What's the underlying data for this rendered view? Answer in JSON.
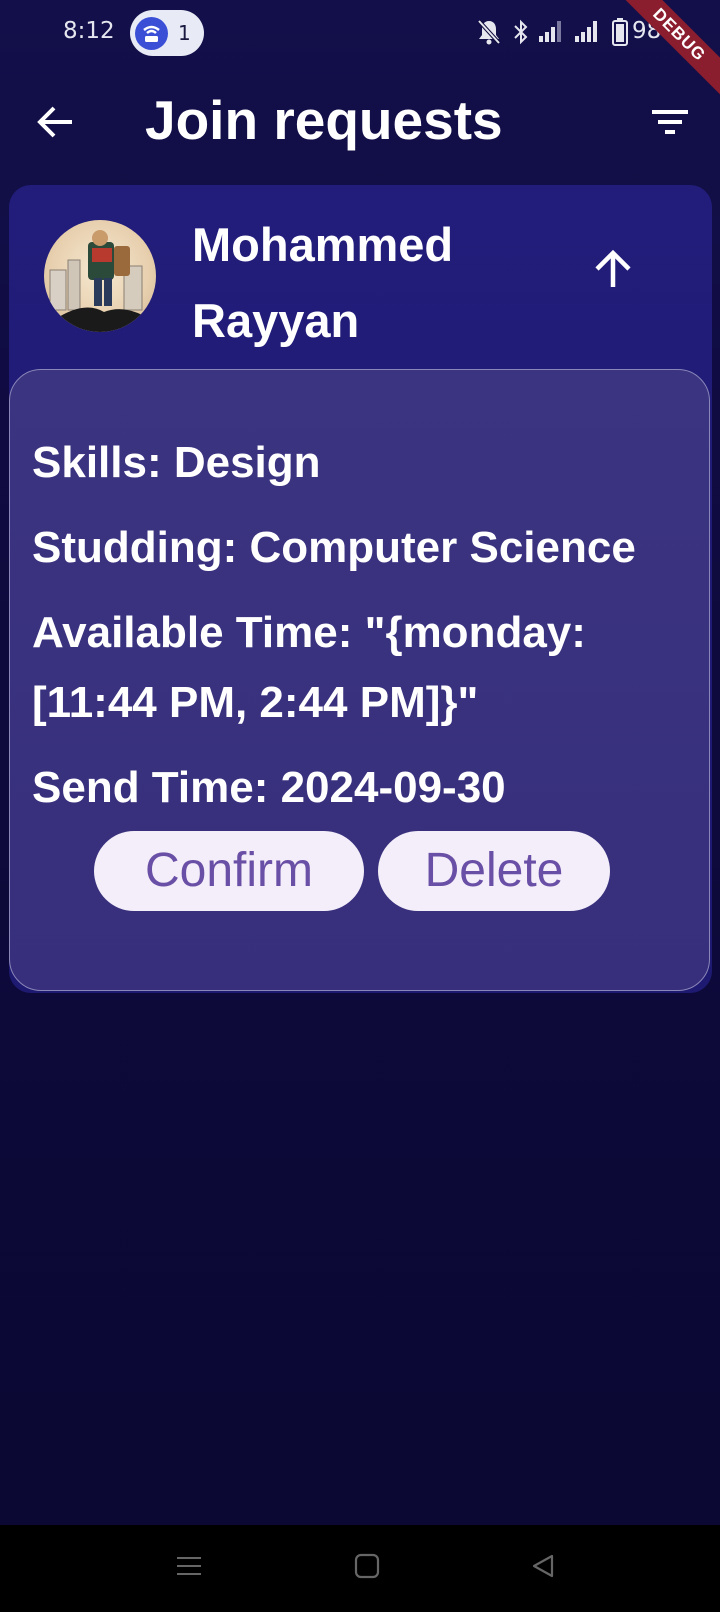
{
  "status_bar": {
    "time": "8:12",
    "hotspot_count": "1",
    "battery": "98%"
  },
  "app_bar": {
    "title": "Join requests",
    "back_icon": "arrow-left-icon",
    "filter_icon": "filter-icon"
  },
  "debug_banner": "DEBUG",
  "request": {
    "name": "Mohammed Rayyan",
    "toggle_icon": "arrow-up-icon",
    "skills": "Skills: Design",
    "studying": "Studding: Computer Science",
    "available_time_line1": "Available Time: \"{monday:",
    "available_time_line2": "[11:44 PM, 2:44 PM]}\"",
    "send_time": "Send Time: 2024-09-30",
    "confirm_label": "Confirm",
    "delete_label": "Delete"
  },
  "colors": {
    "background": "#0e0a3c",
    "card": "#221d7a",
    "panel": "#3b3480",
    "button_bg": "#f3eef9",
    "button_text": "#6a4fa6",
    "debug": "#8b1e2e"
  }
}
